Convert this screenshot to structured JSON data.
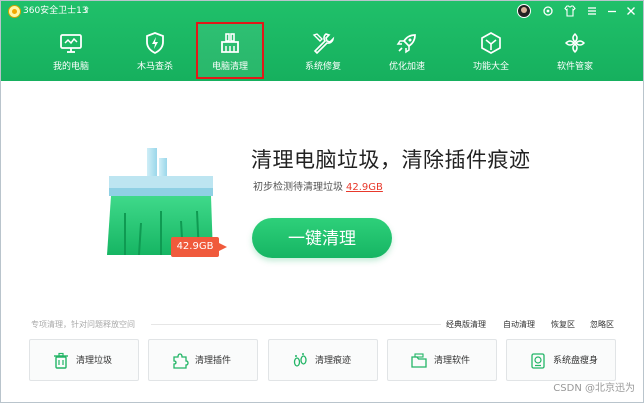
{
  "app": {
    "title": "360安全卫士13",
    "update_icon": "up-arrow-icon"
  },
  "window": {
    "controls": [
      "avatar",
      "skin-icon",
      "shirt-icon",
      "menu-icon",
      "minimize-icon",
      "close-icon"
    ]
  },
  "nav": {
    "items": [
      {
        "label": "我的电脑",
        "icon": "monitor-icon"
      },
      {
        "label": "木马查杀",
        "icon": "shield-icon"
      },
      {
        "label": "电脑清理",
        "icon": "broom-icon",
        "active": true
      },
      {
        "label": "系统修复",
        "icon": "wrench-icon"
      },
      {
        "label": "优化加速",
        "icon": "rocket-icon"
      },
      {
        "label": "功能大全",
        "icon": "box-icon"
      },
      {
        "label": "软件管家",
        "icon": "flower-icon"
      }
    ]
  },
  "hero": {
    "headline": "清理电脑垃圾，清除插件痕迹",
    "subline_prefix": "初步检测待清理垃圾",
    "subline_size": "42.9GB",
    "tag_size": "42.9GB",
    "button_label": "一键清理"
  },
  "options": {
    "hint": "专项清理，针对问题释放空间",
    "links": [
      "经典版清理",
      "自动清理",
      "恢复区",
      "忽略区"
    ]
  },
  "tools": [
    {
      "label": "清理垃圾",
      "icon": "trash-icon"
    },
    {
      "label": "清理插件",
      "icon": "puzzle-icon"
    },
    {
      "label": "清理痕迹",
      "icon": "footprint-icon"
    },
    {
      "label": "清理软件",
      "icon": "folder-icon"
    },
    {
      "label": "系统盘瘦身",
      "icon": "disk-icon"
    }
  ],
  "watermark": "CSDN @北京迅为",
  "colors": {
    "brand_green": "#16b05e",
    "accent_red": "#e8392c",
    "active_outline": "#e21818"
  }
}
